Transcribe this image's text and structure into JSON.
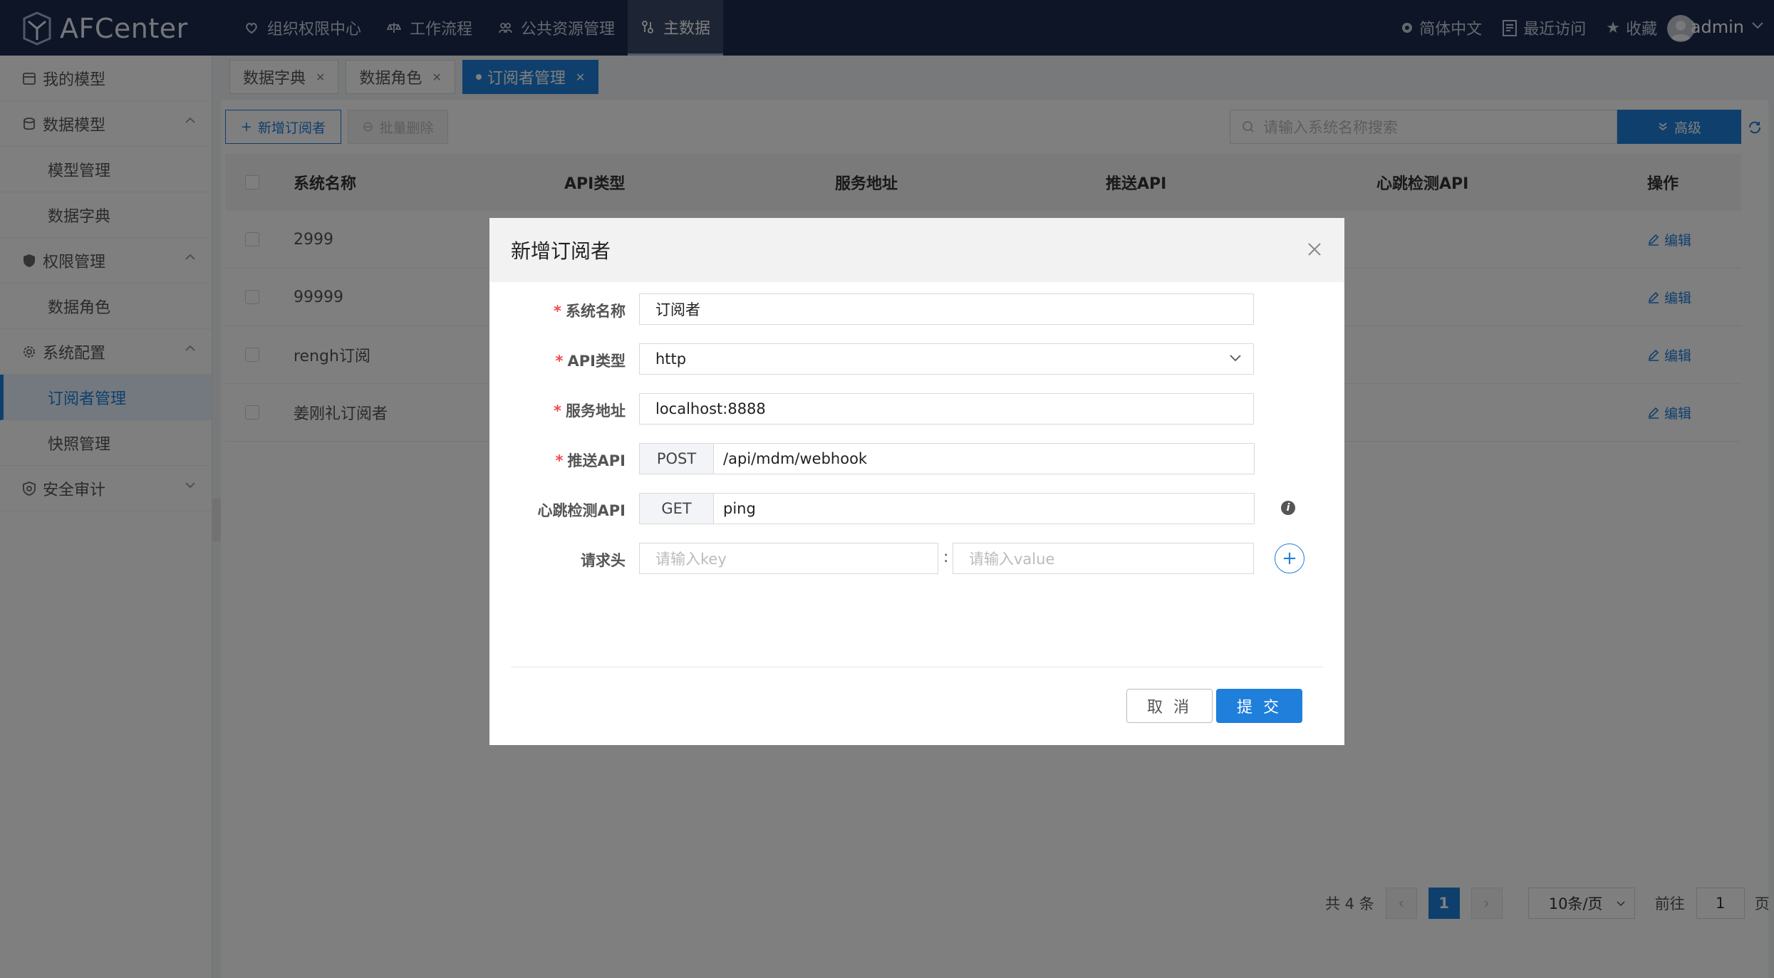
{
  "app": {
    "name": "AFCenter"
  },
  "topnav": [
    {
      "label": "组织权限中心",
      "icon": "heart-shield-icon"
    },
    {
      "label": "工作流程",
      "icon": "scale-icon"
    },
    {
      "label": "公共资源管理",
      "icon": "people-icon"
    },
    {
      "label": "主数据",
      "icon": "data-icon",
      "active": true
    }
  ],
  "topright": {
    "language": "简体中文",
    "recent": "最近访问",
    "favorites": "收藏",
    "help": "?",
    "username": "admin"
  },
  "sidebar": {
    "items": [
      {
        "label": "我的模型"
      },
      {
        "label": "数据模型"
      },
      {
        "label": "模型管理"
      },
      {
        "label": "数据字典"
      },
      {
        "label": "权限管理"
      },
      {
        "label": "数据角色"
      },
      {
        "label": "系统配置"
      },
      {
        "label": "订阅者管理"
      },
      {
        "label": "快照管理"
      },
      {
        "label": "安全审计"
      }
    ]
  },
  "tabs": [
    {
      "label": "数据字典"
    },
    {
      "label": "数据角色"
    },
    {
      "label": "订阅者管理"
    }
  ],
  "toolbar": {
    "add": "新增订阅者",
    "batch_delete": "批量删除",
    "search_placeholder": "请输入系统名称搜索",
    "advanced": "高级"
  },
  "table": {
    "headers": [
      "系统名称",
      "API类型",
      "服务地址",
      "推送API",
      "心跳检测API",
      "操作"
    ],
    "rows": [
      {
        "name": "2999",
        "op": "编辑"
      },
      {
        "name": "99999",
        "op": "编辑"
      },
      {
        "name": "rengh订阅",
        "op": "编辑"
      },
      {
        "name": "姜刚礼订阅者",
        "op": "编辑"
      }
    ]
  },
  "pagination": {
    "total": "共 4 条",
    "current": "1",
    "page_size": "10条/页",
    "goto": "前往",
    "goto_value": "1",
    "unit": "页"
  },
  "modal": {
    "title": "新增订阅者",
    "fields": {
      "system_name": {
        "label": "系统名称",
        "value": "订阅者"
      },
      "api_type": {
        "label": "API类型",
        "value": "http"
      },
      "service_addr": {
        "label": "服务地址",
        "value": "localhost:8888"
      },
      "push_api": {
        "label": "推送API",
        "method": "POST",
        "value": "/api/mdm/webhook"
      },
      "heartbeat_api": {
        "label": "心跳检测API",
        "method": "GET",
        "value": "ping"
      },
      "headers": {
        "label": "请求头",
        "key_placeholder": "请输入key",
        "separator": ":",
        "value_placeholder": "请输入value"
      }
    },
    "required_mark": "*",
    "cancel": "取 消",
    "submit": "提 交"
  },
  "colors": {
    "primary": "#1f7fdb",
    "header_bg": "#1b2a4e",
    "required": "#f04b4b"
  }
}
